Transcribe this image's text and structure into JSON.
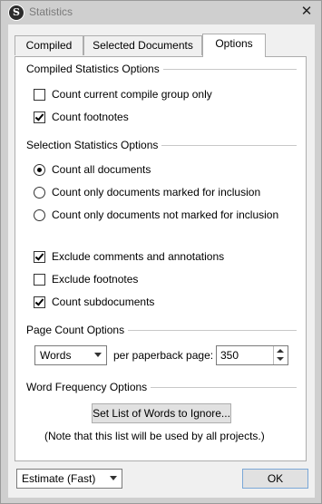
{
  "window": {
    "title": "Statistics",
    "close_symbol": "✕",
    "app_icon_letter": "S"
  },
  "tabs": [
    {
      "label": "Compiled",
      "active": false
    },
    {
      "label": "Selected Documents",
      "active": false
    },
    {
      "label": "Options",
      "active": true
    }
  ],
  "compiled": {
    "title": "Compiled Statistics Options",
    "options": [
      {
        "label": "Count current compile group only",
        "checked": false
      },
      {
        "label": "Count footnotes",
        "checked": true
      }
    ]
  },
  "selection": {
    "title": "Selection Statistics Options",
    "radios": [
      {
        "label": "Count all documents",
        "selected": true
      },
      {
        "label": "Count only documents marked for inclusion",
        "selected": false
      },
      {
        "label": "Count only documents not marked for inclusion",
        "selected": false
      }
    ],
    "checks": [
      {
        "label": "Exclude comments and annotations",
        "checked": true
      },
      {
        "label": "Exclude footnotes",
        "checked": false
      },
      {
        "label": "Count subdocuments",
        "checked": true
      }
    ]
  },
  "page_count": {
    "title": "Page Count Options",
    "unit_value": "Words",
    "per_label": "per paperback page:",
    "per_value": "350"
  },
  "word_frequency": {
    "title": "Word Frequency Options",
    "button_label": "Set List of Words to Ignore...",
    "note": "(Note that this list will be used by all projects.)"
  },
  "footer": {
    "mode_value": "Estimate (Fast)",
    "ok_label": "OK"
  }
}
